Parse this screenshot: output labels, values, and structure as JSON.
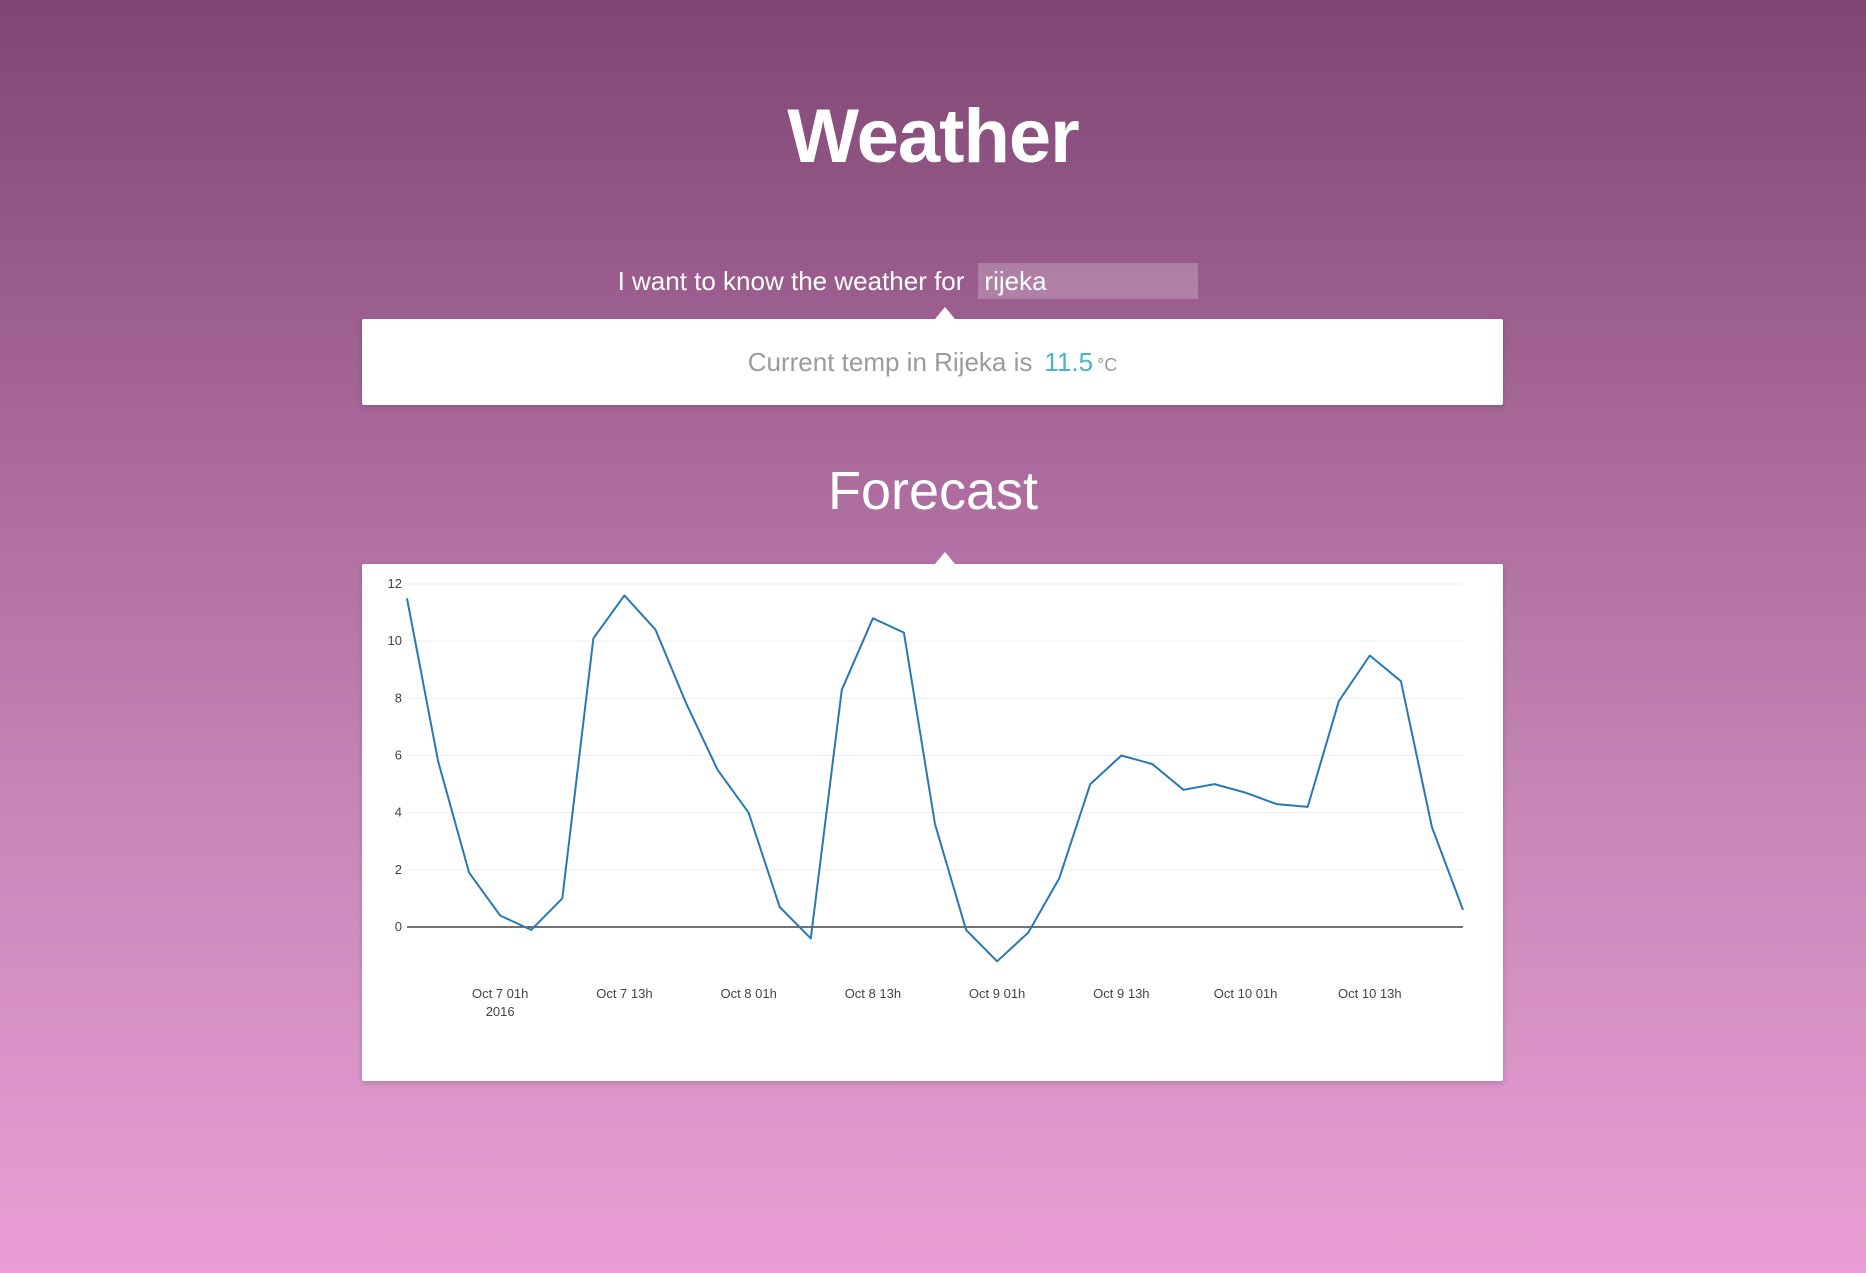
{
  "header": {
    "title": "Weather"
  },
  "query": {
    "label": "I want to know the weather for",
    "value": "rijeka"
  },
  "current": {
    "label": "Current temp in Rijeka is",
    "value": "11.5",
    "unit": "°C"
  },
  "forecast": {
    "title": "Forecast"
  },
  "colors": {
    "line": "#2878b4",
    "accent": "#4eb3c8"
  },
  "chart_data": {
    "type": "line",
    "title": "",
    "xlabel": "",
    "ylabel": "",
    "ylim": [
      -1.5,
      12
    ],
    "yticks": [
      0,
      2,
      4,
      6,
      8,
      10,
      12
    ],
    "grid": true,
    "x": [
      "2016-10-06 16:00",
      "2016-10-06 19:00",
      "2016-10-06 22:00",
      "2016-10-07 01:00",
      "2016-10-07 04:00",
      "2016-10-07 07:00",
      "2016-10-07 10:00",
      "2016-10-07 13:00",
      "2016-10-07 16:00",
      "2016-10-07 19:00",
      "2016-10-07 22:00",
      "2016-10-08 01:00",
      "2016-10-08 04:00",
      "2016-10-08 07:00",
      "2016-10-08 10:00",
      "2016-10-08 13:00",
      "2016-10-08 16:00",
      "2016-10-08 19:00",
      "2016-10-08 22:00",
      "2016-10-09 01:00",
      "2016-10-09 04:00",
      "2016-10-09 07:00",
      "2016-10-09 10:00",
      "2016-10-09 13:00",
      "2016-10-09 16:00",
      "2016-10-09 19:00",
      "2016-10-09 22:00",
      "2016-10-10 01:00",
      "2016-10-10 04:00",
      "2016-10-10 07:00",
      "2016-10-10 10:00",
      "2016-10-10 13:00",
      "2016-10-10 16:00",
      "2016-10-10 19:00",
      "2016-10-10 22:00"
    ],
    "series": [
      {
        "values": [
          11.5,
          5.8,
          1.9,
          0.4,
          -0.1,
          1.0,
          10.1,
          11.6,
          10.4,
          7.8,
          5.5,
          4.0,
          0.7,
          -0.4,
          8.3,
          10.8,
          10.3,
          3.6,
          -0.1,
          -1.2,
          -0.2,
          1.7,
          5.0,
          6.0,
          5.7,
          4.8,
          5.0,
          4.7,
          4.3,
          4.2,
          7.9,
          9.5,
          8.6,
          3.5,
          0.6
        ]
      }
    ],
    "xtick_labels": [
      "Oct 7 01h",
      "Oct 7 13h",
      "Oct 8 01h",
      "Oct 8 13h",
      "Oct 9 01h",
      "Oct 9 13h",
      "Oct 10 01h",
      "Oct 10 13h"
    ],
    "xtick_sublabel": "2016"
  }
}
